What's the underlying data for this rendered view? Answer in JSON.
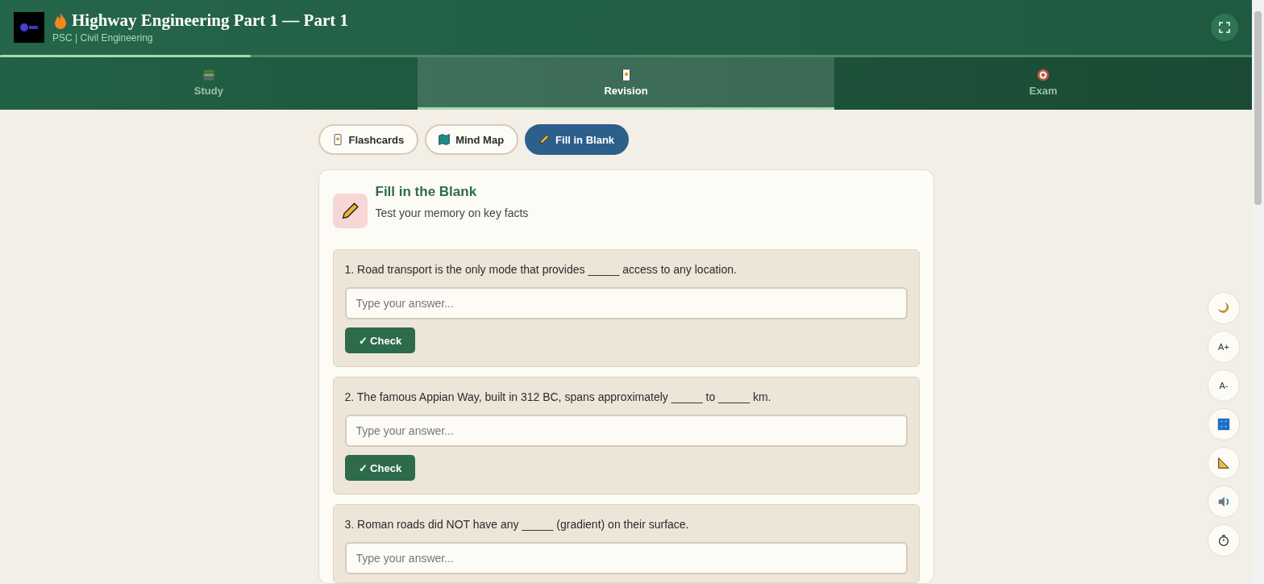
{
  "header": {
    "title": "Highway Engineering Part 1 — Part 1",
    "subtitle": "PSC | Civil Engineering",
    "progress": {
      "level": 0.2
    }
  },
  "main_tabs": [
    {
      "label": "Study",
      "selected": false
    },
    {
      "label": "Revision",
      "selected": true
    },
    {
      "label": "Exam",
      "selected": false
    }
  ],
  "sub_tabs": [
    {
      "label": "Flashcards",
      "selected": false
    },
    {
      "label": "Mind Map",
      "selected": false
    },
    {
      "label": "Fill in Blank",
      "selected": true
    }
  ],
  "panel": {
    "title": "Fill in the Blank",
    "subtitle": "Test your memory on key facts"
  },
  "questions": [
    {
      "text": "1. Road transport is the only mode that provides _____ access to any location.",
      "placeholder": "Type your answer...",
      "button": "✓ Check"
    },
    {
      "text": "2. The famous Appian Way, built in 312 BC, spans approximately _____ to _____ km.",
      "placeholder": "Type your answer...",
      "button": "✓ Check"
    },
    {
      "text": "3. Roman roads did NOT have any _____ (gradient) on their surface.",
      "placeholder": "Type your answer..."
    }
  ],
  "side_tools": [
    {
      "kind": "icon"
    },
    {
      "kind": "text",
      "label": "A+"
    },
    {
      "kind": "text",
      "label": "A-"
    },
    {
      "kind": "icon"
    },
    {
      "kind": "icon"
    },
    {
      "kind": "icon"
    },
    {
      "kind": "icon"
    }
  ]
}
